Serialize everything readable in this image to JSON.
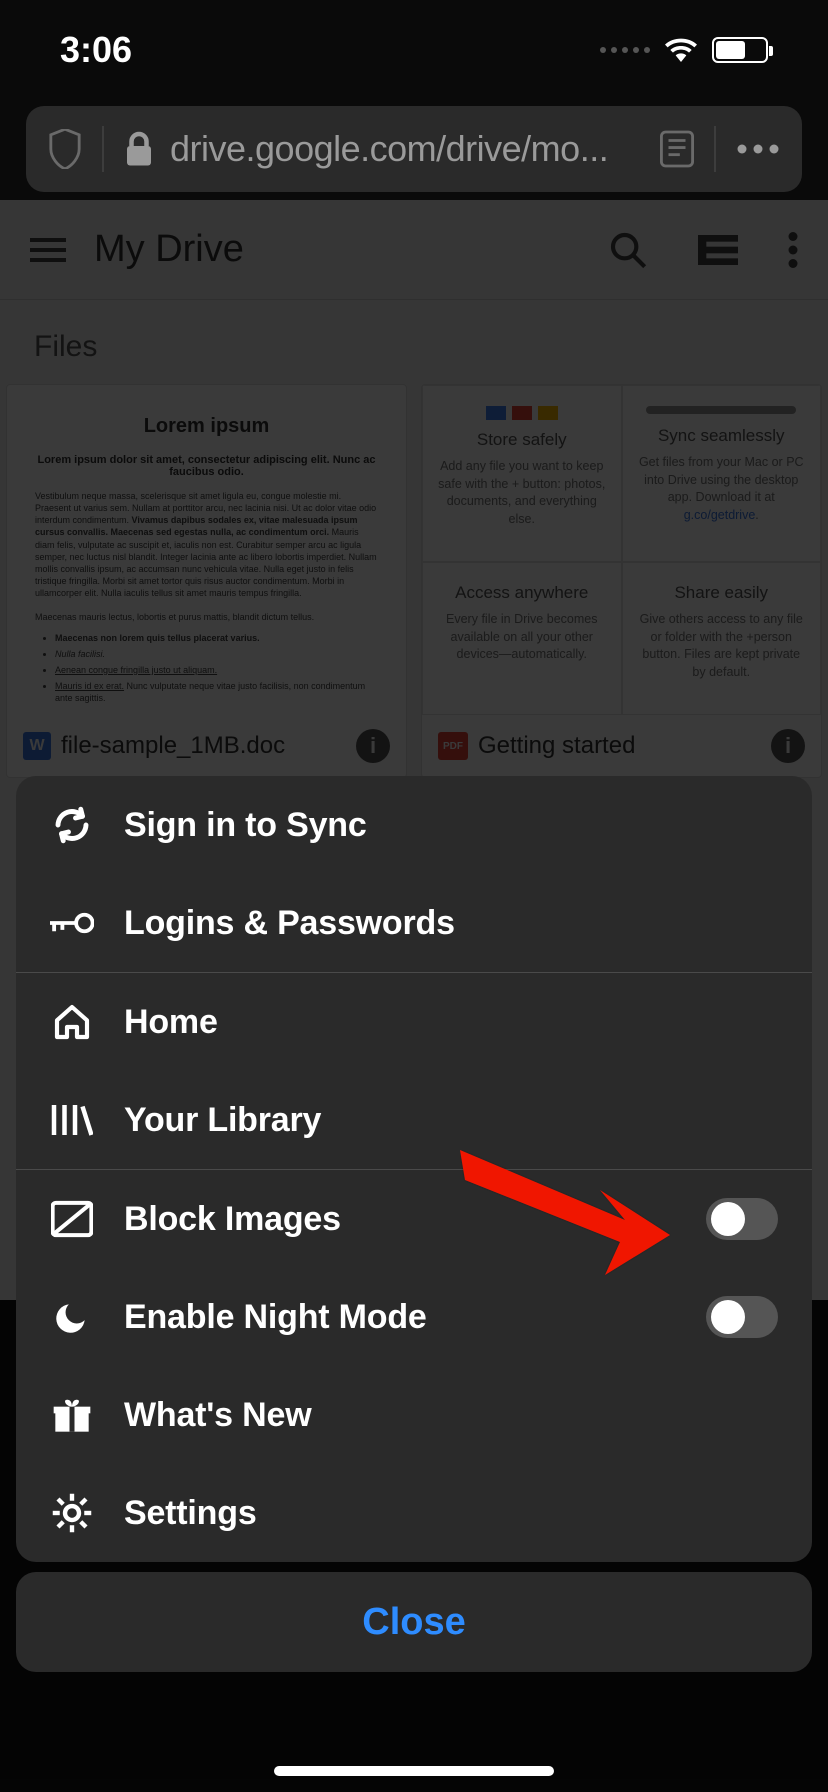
{
  "status": {
    "time": "3:06"
  },
  "url_bar": {
    "url_display": "drive.google.com/drive/mo..."
  },
  "drive": {
    "title": "My Drive",
    "section_label": "Files",
    "files": [
      {
        "icon": "W",
        "name": "file-sample_1MB.doc",
        "preview_title": "Lorem ipsum",
        "preview_subtitle": "Lorem ipsum dolor sit amet, consectetur adipiscing elit. Nunc ac faucibus odio."
      },
      {
        "icon": "PDF",
        "name": "Getting started"
      }
    ],
    "promo": {
      "cells": [
        {
          "title": "Store safely",
          "text": "Add any file you want to keep safe with the + button: photos, documents, and everything else."
        },
        {
          "title": "Sync seamlessly",
          "text": "Get files from your Mac or PC into Drive using the desktop app. Download it at",
          "link": "g.co/getdrive"
        },
        {
          "title": "Access anywhere",
          "text": "Every file in Drive becomes available on all your other devices—automatically."
        },
        {
          "title": "Share easily",
          "text": "Give others access to any file or folder with the +person button. Files are kept private by default."
        }
      ]
    }
  },
  "menu": {
    "sign_in": "Sign in to Sync",
    "logins": "Logins & Passwords",
    "home": "Home",
    "library": "Your Library",
    "block_images": "Block Images",
    "night_mode": "Enable Night Mode",
    "whats_new": "What's New",
    "settings": "Settings",
    "block_images_on": false,
    "night_mode_on": false
  },
  "close_label": "Close"
}
